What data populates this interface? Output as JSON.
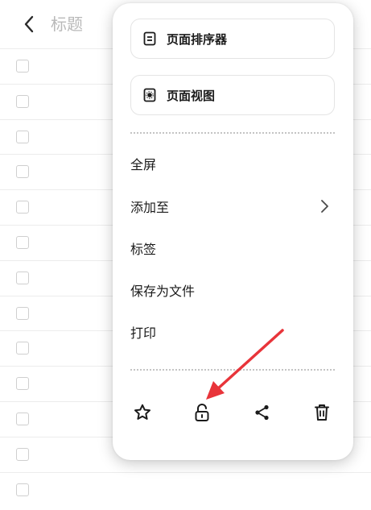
{
  "header": {
    "title": "标题"
  },
  "list": {
    "row_count": 13
  },
  "menu": {
    "pills": [
      {
        "label": "页面排序器",
        "icon": "list-sorter-icon"
      },
      {
        "label": "页面视图",
        "icon": "page-view-icon"
      }
    ],
    "items": [
      {
        "label": "全屏"
      },
      {
        "label": "添加至",
        "has_submenu": true
      },
      {
        "label": "标签"
      },
      {
        "label": "保存为文件"
      },
      {
        "label": "打印"
      }
    ],
    "bottom_icons": [
      "star-icon",
      "unlock-icon",
      "share-icon",
      "trash-icon"
    ]
  },
  "colors": {
    "annotation_arrow": "#e8343a",
    "title_gray": "#b9b9b9"
  }
}
